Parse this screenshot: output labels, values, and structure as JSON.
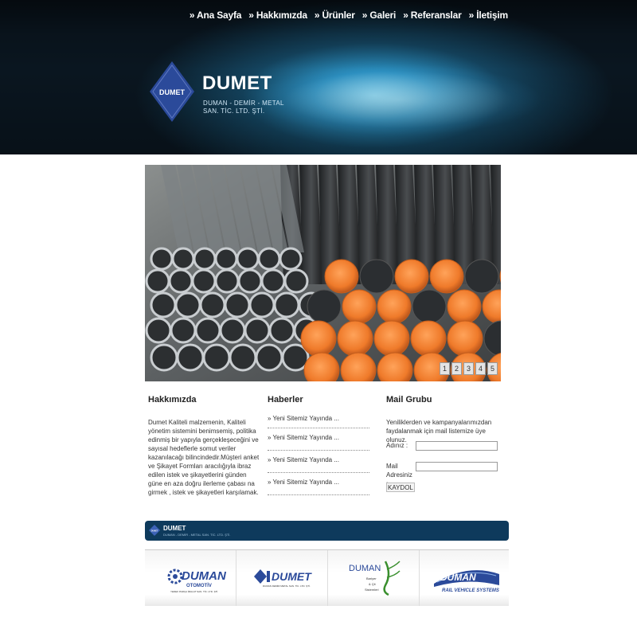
{
  "nav": {
    "items": [
      "» Ana Sayfa",
      "» Hakkımızda",
      "» Ürünler",
      "» Galeri",
      "» Referanslar",
      "» İletişim"
    ]
  },
  "brand": {
    "mark_text": "DUMET",
    "name": "DUMET",
    "subtitle_line1": "DUMAN - DEMİR - METAL",
    "subtitle_line2": "SAN. TİC. LTD. ŞTİ."
  },
  "slider": {
    "pages": [
      "1",
      "2",
      "3",
      "4",
      "5"
    ],
    "active_page": "5"
  },
  "about": {
    "title": "Hakkımızda",
    "text": "Dumet Kaliteli malzemenin, Kaliteli yönetim sistemini benimsemiş, politika edinmiş bir yapıyla gerçekleşeceğini ve sayısal hedeflerle somut veriler kazanılacağı bilincindedir.Müşteri anket ve Şikayet Formları aracılığıyla ibraz edilen istek ve şikayetlerini günden güne en aza doğru ilerleme çabası na girmek , istek ve  şikayetleri karşılamak."
  },
  "news": {
    "title": "Haberler",
    "items": [
      "» Yeni Sitemiz Yayında ...",
      "» Yeni Sitemiz Yayında ...",
      "» Yeni Sitemiz Yayında ...",
      "» Yeni Sitemiz Yayında ..."
    ]
  },
  "mail": {
    "title": "Mail Grubu",
    "intro": "Yeniliklerden ve kampanyalarımızdan faydalanmak için mail listemize üye olunuz.",
    "name_label": "Adınız :",
    "name_value": "",
    "email_label": "Mail Adresiniz :",
    "email_value": "",
    "submit_label": "KAYDOL"
  },
  "footer": {
    "mark_text": "DUMET",
    "name": "DUMET",
    "subtitle": "DUMAN - DEMİR - METAL SAN. TİC. LTD. ŞTİ."
  },
  "partners": {
    "otomotiv": {
      "name": "DUMAN",
      "line2": "OTOMOTİV",
      "line3": "YEDEK PARÇA İMALAT SAN. TİC. LTD. ŞTİ."
    },
    "dumet": {
      "name": "DUMET",
      "line2": "DUMAN DEMİR METAL SAN. TİC. LTD. ŞTİ."
    },
    "bariyer": {
      "name": "DUMAN",
      "line2": "Bariyer",
      "line3": "& Çit",
      "line4": "Sistemleri"
    },
    "rail": {
      "name": "DUMAN",
      "line2": "RAIL VEHICLE SYSTEMS"
    }
  },
  "colors": {
    "brand_blue": "#2b4a9a",
    "footer_bar": "#0e3a5c",
    "pipe_orange": "#ef7a2a"
  }
}
